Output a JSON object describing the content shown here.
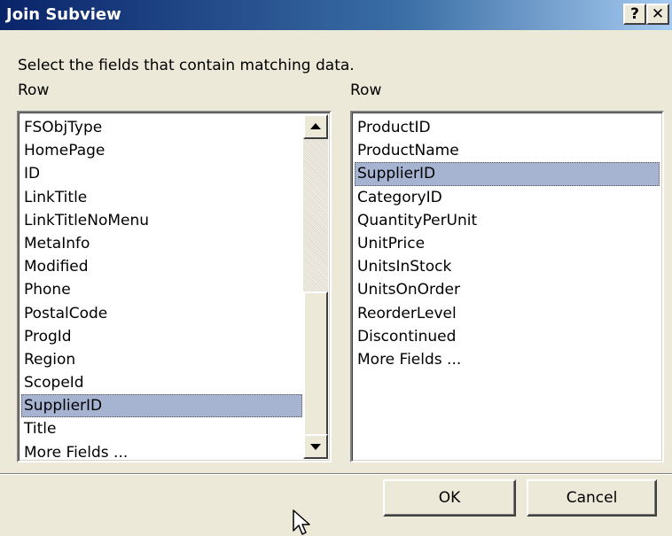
{
  "window": {
    "title": "Join Subview",
    "help_label": "?",
    "close_label": "✕"
  },
  "instruction": "Select the fields that contain matching data.",
  "left_list": {
    "label": "Row",
    "items": [
      {
        "label": "FSObjType"
      },
      {
        "label": "HomePage"
      },
      {
        "label": "ID"
      },
      {
        "label": "LinkTitle"
      },
      {
        "label": "LinkTitleNoMenu"
      },
      {
        "label": "MetaInfo"
      },
      {
        "label": "Modified"
      },
      {
        "label": "Phone"
      },
      {
        "label": "PostalCode"
      },
      {
        "label": "ProgId"
      },
      {
        "label": "Region"
      },
      {
        "label": "ScopeId"
      },
      {
        "label": "SupplierID",
        "selected": true
      },
      {
        "label": "Title"
      },
      {
        "label": "More Fields ..."
      }
    ]
  },
  "right_list": {
    "label": "Row",
    "items": [
      {
        "label": "ProductID"
      },
      {
        "label": "ProductName"
      },
      {
        "label": "SupplierID",
        "selected": true
      },
      {
        "label": "CategoryID"
      },
      {
        "label": "QuantityPerUnit"
      },
      {
        "label": "UnitPrice"
      },
      {
        "label": "UnitsInStock"
      },
      {
        "label": "UnitsOnOrder"
      },
      {
        "label": "ReorderLevel"
      },
      {
        "label": "Discontinued"
      },
      {
        "label": "More Fields ..."
      }
    ]
  },
  "buttons": {
    "ok_label": "OK",
    "cancel_label": "Cancel"
  },
  "colors": {
    "selection": "#a6b4d2",
    "title_bar": "#0a246a",
    "dialog_face": "#ece9d8"
  }
}
